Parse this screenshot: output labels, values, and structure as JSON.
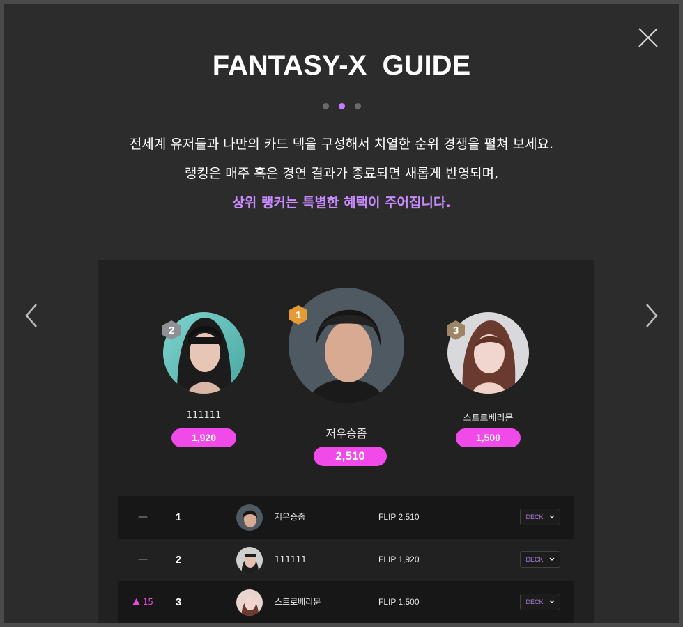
{
  "modal": {
    "title": "FANTASY-X  GUIDE",
    "pagination": {
      "total": 3,
      "active_index": 1
    },
    "description": {
      "line1": "전세계 유저들과 나만의 카드 덱을 구성해서 치열한 순위 경쟁을 펼쳐 보세요.",
      "line2": "랭킹은 매주 혹은 경연 결과가 종료되면 새롭게 반영되며,",
      "highlight": "상위 랭커는 특별한 혜택이 주어집니다."
    },
    "icons": {
      "close": "close-icon",
      "prev": "chevron-left-icon",
      "next": "chevron-right-icon"
    }
  },
  "podium": {
    "first": {
      "rank": "1",
      "name": "저우승좀",
      "score": "2,510",
      "badge_color": "#e39a37"
    },
    "second": {
      "rank": "2",
      "name": "111111",
      "score": "1,920",
      "badge_color": "#8d9196"
    },
    "third": {
      "rank": "3",
      "name": "스트로베리문",
      "score": "1,500",
      "badge_color": "#9e8566"
    }
  },
  "ranking_table": {
    "rows": [
      {
        "change": "—",
        "rank": "1",
        "name": "저우승좀",
        "score": "FLIP 2,510",
        "deck_label": "DECK"
      },
      {
        "change": "—",
        "rank": "2",
        "name": "111111",
        "score": "FLIP 1,920",
        "deck_label": "DECK"
      },
      {
        "change": "15",
        "change_direction": "up",
        "rank": "3",
        "name": "스트로베리문",
        "score": "FLIP 1,500",
        "deck_label": "DECK"
      }
    ]
  },
  "colors": {
    "accent_purple": "#c98bff",
    "score_pill": "#f04ae8",
    "modal_bg": "#2c2c2c",
    "panel_bg": "#212121"
  }
}
